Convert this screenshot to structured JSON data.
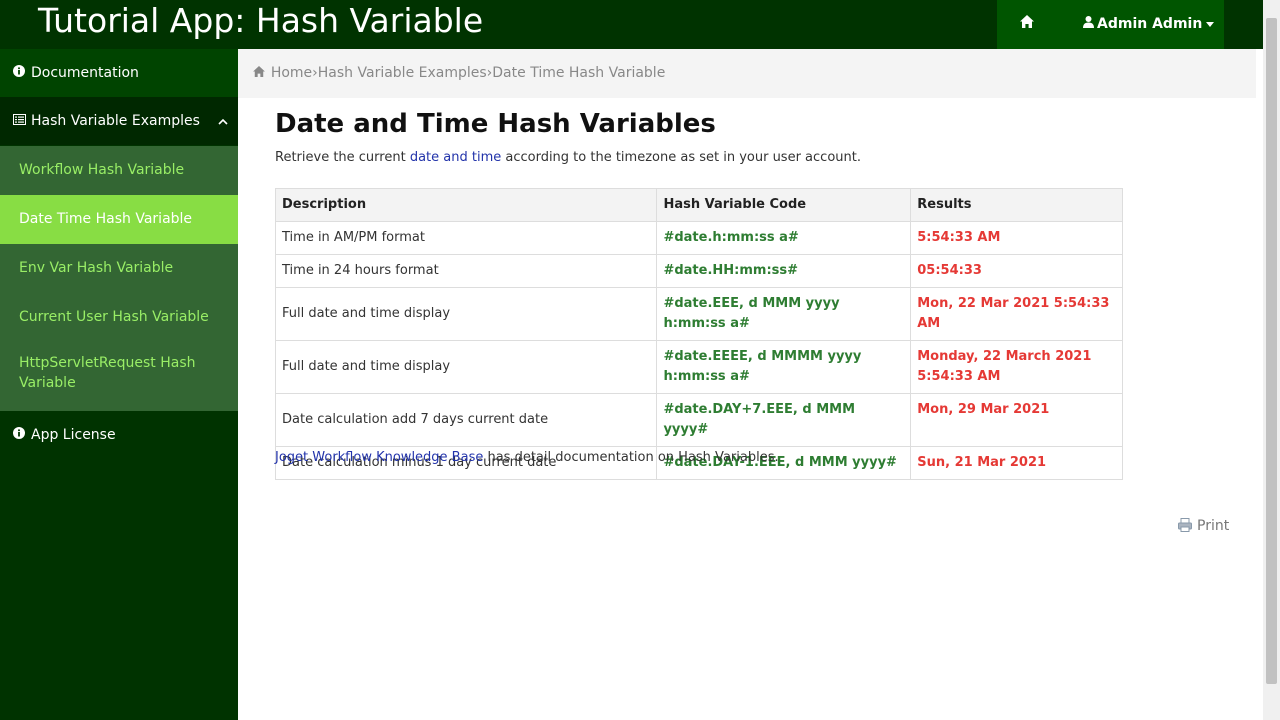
{
  "header": {
    "app_title": "Tutorial App: Hash Variable",
    "home_icon": "home-icon",
    "user_label": "Admin Admin",
    "colors": {
      "bar": "#003300",
      "right_panel": "#005500"
    }
  },
  "sidebar": {
    "documentation": "Documentation",
    "hash_examples": "Hash Variable Examples",
    "sub_items": [
      {
        "label": "Workflow Hash Variable",
        "active": false
      },
      {
        "label": "Date Time Hash Variable",
        "active": true
      },
      {
        "label": "Env Var Hash Variable",
        "active": false
      },
      {
        "label": "Current User Hash Variable",
        "active": false
      },
      {
        "label": "HttpServletRequest Hash Variable",
        "active": false
      }
    ],
    "app_license": "App License",
    "colors": {
      "bg": "#003300",
      "sub_bg": "#336633",
      "active_bg": "#88dd44"
    }
  },
  "breadcrumb": {
    "home": "Home",
    "sep": "›",
    "level1": "Hash Variable Examples",
    "level2": "Date Time Hash Variable"
  },
  "main": {
    "title": "Date and Time Hash Variables",
    "intro_before": "Retrieve the current ",
    "intro_link": "date and time",
    "intro_after": " according to the timezone as set in your user account.",
    "table": {
      "headers": [
        "Description",
        "Hash Variable Code",
        "Results"
      ],
      "rows": [
        {
          "desc": "Time in AM/PM format",
          "code": "#date.h:mm:ss a#",
          "result": "5:54:33 AM"
        },
        {
          "desc": "Time in 24 hours format",
          "code": "#date.HH:mm:ss#",
          "result": "05:54:33"
        },
        {
          "desc": "Full date and time display",
          "code": "#date.EEE, d MMM yyyy h:mm:ss a#",
          "result": "Mon, 22 Mar 2021 5:54:33 AM"
        },
        {
          "desc": "Full date and time display",
          "code": "#date.EEEE, d MMMM yyyy h:mm:ss a#",
          "result": "Monday, 22 March 2021 5:54:33 AM"
        },
        {
          "desc": "Date calculation add 7 days current date",
          "code": "#date.DAY+7.EEE, d MMM yyyy#",
          "result": "Mon, 29 Mar 2021"
        },
        {
          "desc": "Date calculation minus 1 day current date",
          "code": "#date.DAY-1.EEE, d MMM yyyy#",
          "result": "Sun, 21 Mar 2021"
        }
      ]
    },
    "footer_link": "Joget Workflow Knowledge Base",
    "footer_after": " has detail documentation on Hash Variables.",
    "print_label": "Print",
    "colors": {
      "code": "#2e7d32",
      "result": "#e53935",
      "link": "#2233aa"
    }
  }
}
